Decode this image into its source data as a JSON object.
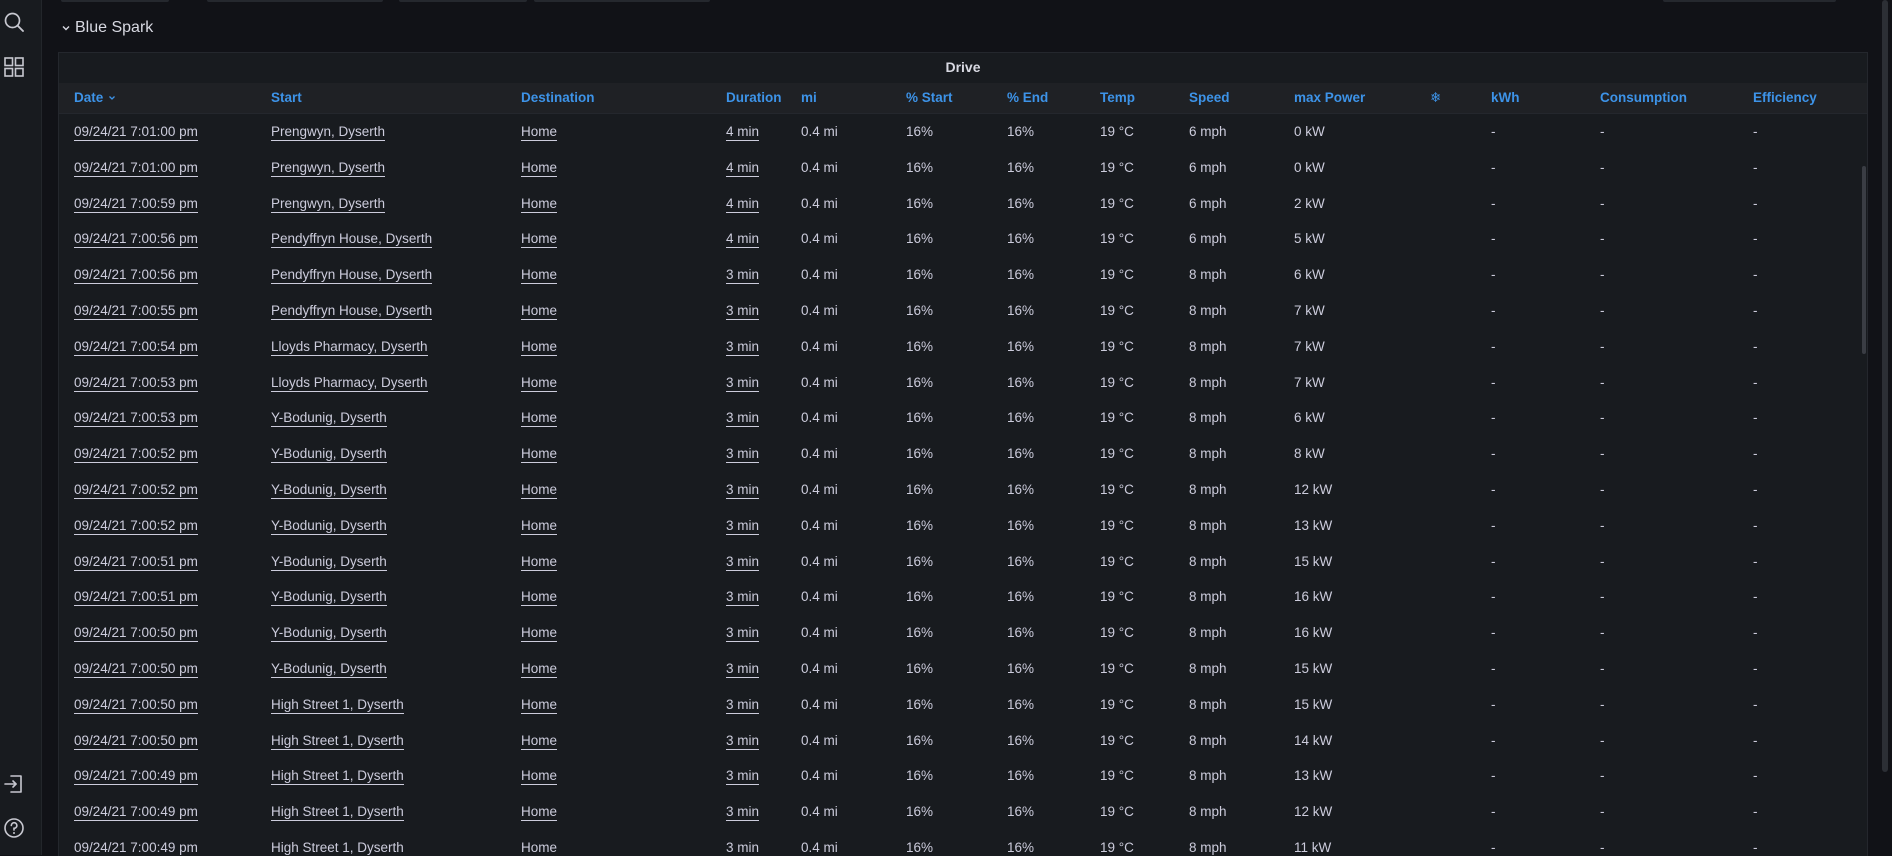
{
  "row": {
    "title": "Blue Spark"
  },
  "panel": {
    "title": "Drive"
  },
  "columns": [
    "Date",
    "Start",
    "Destination",
    "Duration",
    "mi",
    "% Start",
    "% End",
    "Temp",
    "Speed",
    "max Power",
    "❄",
    "kWh",
    "Consumption",
    "Efficiency"
  ],
  "sort": {
    "column": "Date",
    "direction": "desc"
  },
  "rows": [
    [
      "09/24/21 7:01:00 pm",
      "Prengwyn, Dyserth",
      "Home",
      "4 min",
      "0.4 mi",
      "16%",
      "16%",
      "19 °C",
      "6 mph",
      "0 kW",
      "",
      "-",
      "-",
      "-"
    ],
    [
      "09/24/21 7:01:00 pm",
      "Prengwyn, Dyserth",
      "Home",
      "4 min",
      "0.4 mi",
      "16%",
      "16%",
      "19 °C",
      "6 mph",
      "0 kW",
      "",
      "-",
      "-",
      "-"
    ],
    [
      "09/24/21 7:00:59 pm",
      "Prengwyn, Dyserth",
      "Home",
      "4 min",
      "0.4 mi",
      "16%",
      "16%",
      "19 °C",
      "6 mph",
      "2 kW",
      "",
      "-",
      "-",
      "-"
    ],
    [
      "09/24/21 7:00:56 pm",
      "Pendyffryn House, Dyserth",
      "Home",
      "4 min",
      "0.4 mi",
      "16%",
      "16%",
      "19 °C",
      "6 mph",
      "5 kW",
      "",
      "-",
      "-",
      "-"
    ],
    [
      "09/24/21 7:00:56 pm",
      "Pendyffryn House, Dyserth",
      "Home",
      "3 min",
      "0.4 mi",
      "16%",
      "16%",
      "19 °C",
      "8 mph",
      "6 kW",
      "",
      "-",
      "-",
      "-"
    ],
    [
      "09/24/21 7:00:55 pm",
      "Pendyffryn House, Dyserth",
      "Home",
      "3 min",
      "0.4 mi",
      "16%",
      "16%",
      "19 °C",
      "8 mph",
      "7 kW",
      "",
      "-",
      "-",
      "-"
    ],
    [
      "09/24/21 7:00:54 pm",
      "Lloyds Pharmacy, Dyserth",
      "Home",
      "3 min",
      "0.4 mi",
      "16%",
      "16%",
      "19 °C",
      "8 mph",
      "7 kW",
      "",
      "-",
      "-",
      "-"
    ],
    [
      "09/24/21 7:00:53 pm",
      "Lloyds Pharmacy, Dyserth",
      "Home",
      "3 min",
      "0.4 mi",
      "16%",
      "16%",
      "19 °C",
      "8 mph",
      "7 kW",
      "",
      "-",
      "-",
      "-"
    ],
    [
      "09/24/21 7:00:53 pm",
      "Y-Bodunig, Dyserth",
      "Home",
      "3 min",
      "0.4 mi",
      "16%",
      "16%",
      "19 °C",
      "8 mph",
      "6 kW",
      "",
      "-",
      "-",
      "-"
    ],
    [
      "09/24/21 7:00:52 pm",
      "Y-Bodunig, Dyserth",
      "Home",
      "3 min",
      "0.4 mi",
      "16%",
      "16%",
      "19 °C",
      "8 mph",
      "8 kW",
      "",
      "-",
      "-",
      "-"
    ],
    [
      "09/24/21 7:00:52 pm",
      "Y-Bodunig, Dyserth",
      "Home",
      "3 min",
      "0.4 mi",
      "16%",
      "16%",
      "19 °C",
      "8 mph",
      "12 kW",
      "",
      "-",
      "-",
      "-"
    ],
    [
      "09/24/21 7:00:52 pm",
      "Y-Bodunig, Dyserth",
      "Home",
      "3 min",
      "0.4 mi",
      "16%",
      "16%",
      "19 °C",
      "8 mph",
      "13 kW",
      "",
      "-",
      "-",
      "-"
    ],
    [
      "09/24/21 7:00:51 pm",
      "Y-Bodunig, Dyserth",
      "Home",
      "3 min",
      "0.4 mi",
      "16%",
      "16%",
      "19 °C",
      "8 mph",
      "15 kW",
      "",
      "-",
      "-",
      "-"
    ],
    [
      "09/24/21 7:00:51 pm",
      "Y-Bodunig, Dyserth",
      "Home",
      "3 min",
      "0.4 mi",
      "16%",
      "16%",
      "19 °C",
      "8 mph",
      "16 kW",
      "",
      "-",
      "-",
      "-"
    ],
    [
      "09/24/21 7:00:50 pm",
      "Y-Bodunig, Dyserth",
      "Home",
      "3 min",
      "0.4 mi",
      "16%",
      "16%",
      "19 °C",
      "8 mph",
      "16 kW",
      "",
      "-",
      "-",
      "-"
    ],
    [
      "09/24/21 7:00:50 pm",
      "Y-Bodunig, Dyserth",
      "Home",
      "3 min",
      "0.4 mi",
      "16%",
      "16%",
      "19 °C",
      "8 mph",
      "15 kW",
      "",
      "-",
      "-",
      "-"
    ],
    [
      "09/24/21 7:00:50 pm",
      "High Street 1, Dyserth",
      "Home",
      "3 min",
      "0.4 mi",
      "16%",
      "16%",
      "19 °C",
      "8 mph",
      "15 kW",
      "",
      "-",
      "-",
      "-"
    ],
    [
      "09/24/21 7:00:50 pm",
      "High Street 1, Dyserth",
      "Home",
      "3 min",
      "0.4 mi",
      "16%",
      "16%",
      "19 °C",
      "8 mph",
      "14 kW",
      "",
      "-",
      "-",
      "-"
    ],
    [
      "09/24/21 7:00:49 pm",
      "High Street 1, Dyserth",
      "Home",
      "3 min",
      "0.4 mi",
      "16%",
      "16%",
      "19 °C",
      "8 mph",
      "13 kW",
      "",
      "-",
      "-",
      "-"
    ],
    [
      "09/24/21 7:00:49 pm",
      "High Street 1, Dyserth",
      "Home",
      "3 min",
      "0.4 mi",
      "16%",
      "16%",
      "19 °C",
      "8 mph",
      "12 kW",
      "",
      "-",
      "-",
      "-"
    ],
    [
      "09/24/21 7:00:49 pm",
      "High Street 1, Dyserth",
      "Home",
      "3 min",
      "0.4 mi",
      "16%",
      "16%",
      "19 °C",
      "8 mph",
      "11 kW",
      "",
      "-",
      "-",
      "-"
    ]
  ],
  "sidebar": {
    "icons": [
      "search-icon",
      "dashboards-icon",
      "sign-in-icon",
      "help-icon"
    ]
  },
  "colors": {
    "background": "#111217",
    "panel": "#181b1f",
    "header_text": "#3d93e8",
    "text": "#ccccdc"
  }
}
